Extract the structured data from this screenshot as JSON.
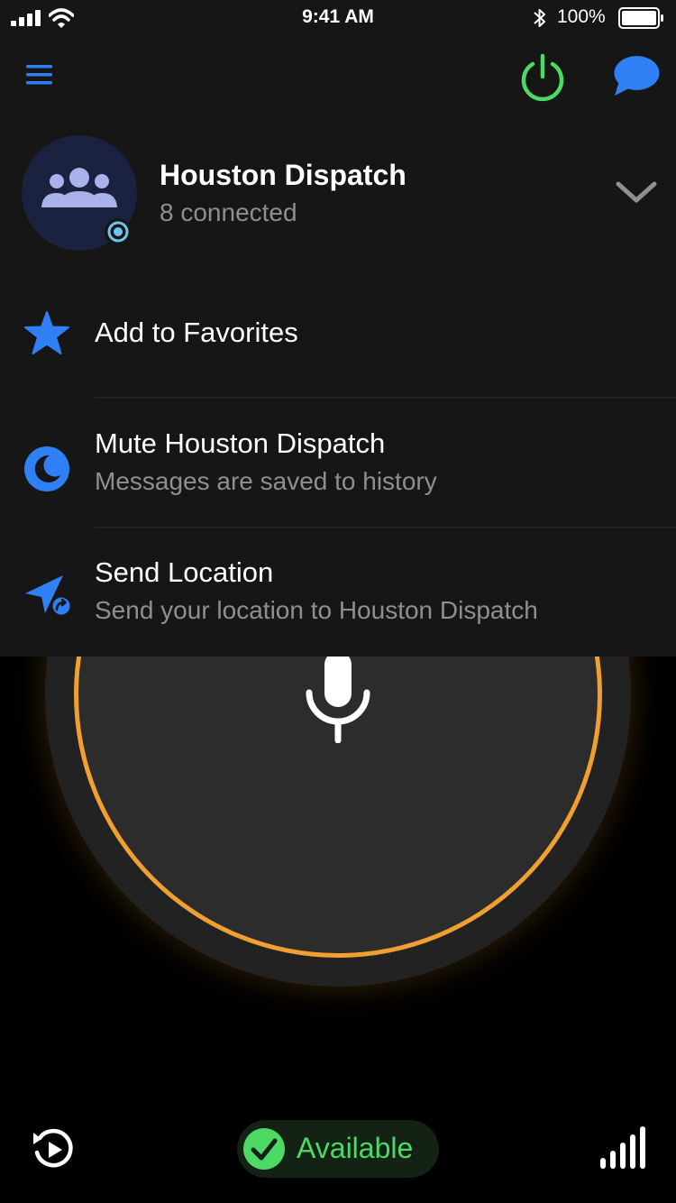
{
  "status_bar": {
    "time": "9:41 AM",
    "battery_percent": "100%",
    "battery_level": 1.0,
    "icons": [
      "cellular-signal-icon",
      "wifi-icon",
      "bluetooth-icon",
      "battery-icon"
    ]
  },
  "toolbar": {
    "icons": [
      "hamburger-menu-icon",
      "power-icon",
      "chat-bubble-icon"
    ]
  },
  "channel": {
    "name": "Houston Dispatch",
    "status": "8 connected",
    "avatar_icon": "group-icon",
    "presence_icon": "target-dot-icon",
    "expand_icon": "chevron-down-icon"
  },
  "menu": {
    "items": [
      {
        "title": "Add to Favorites",
        "subtitle": "",
        "icon": "star-icon"
      },
      {
        "title": "Mute Houston Dispatch",
        "subtitle": "Messages are saved to history",
        "icon": "moon-icon"
      },
      {
        "title": "Send Location",
        "subtitle": "Send your location to Houston Dispatch",
        "icon": "send-location-icon"
      }
    ]
  },
  "ptt": {
    "icon": "microphone-icon"
  },
  "bottom_bar": {
    "availability_label": "Available",
    "icons": [
      "replay-icon",
      "checkmark-icon",
      "signal-strength-icon"
    ]
  },
  "colors": {
    "accent_blue": "#2f7ff5",
    "power_green": "#4cd964",
    "ring_orange": "#f0a030",
    "panel_background": "#161616",
    "secondary_text": "#8e8e93",
    "avatar_icon": "#a9b2ea",
    "presence_badge": "#6cc4ef"
  }
}
